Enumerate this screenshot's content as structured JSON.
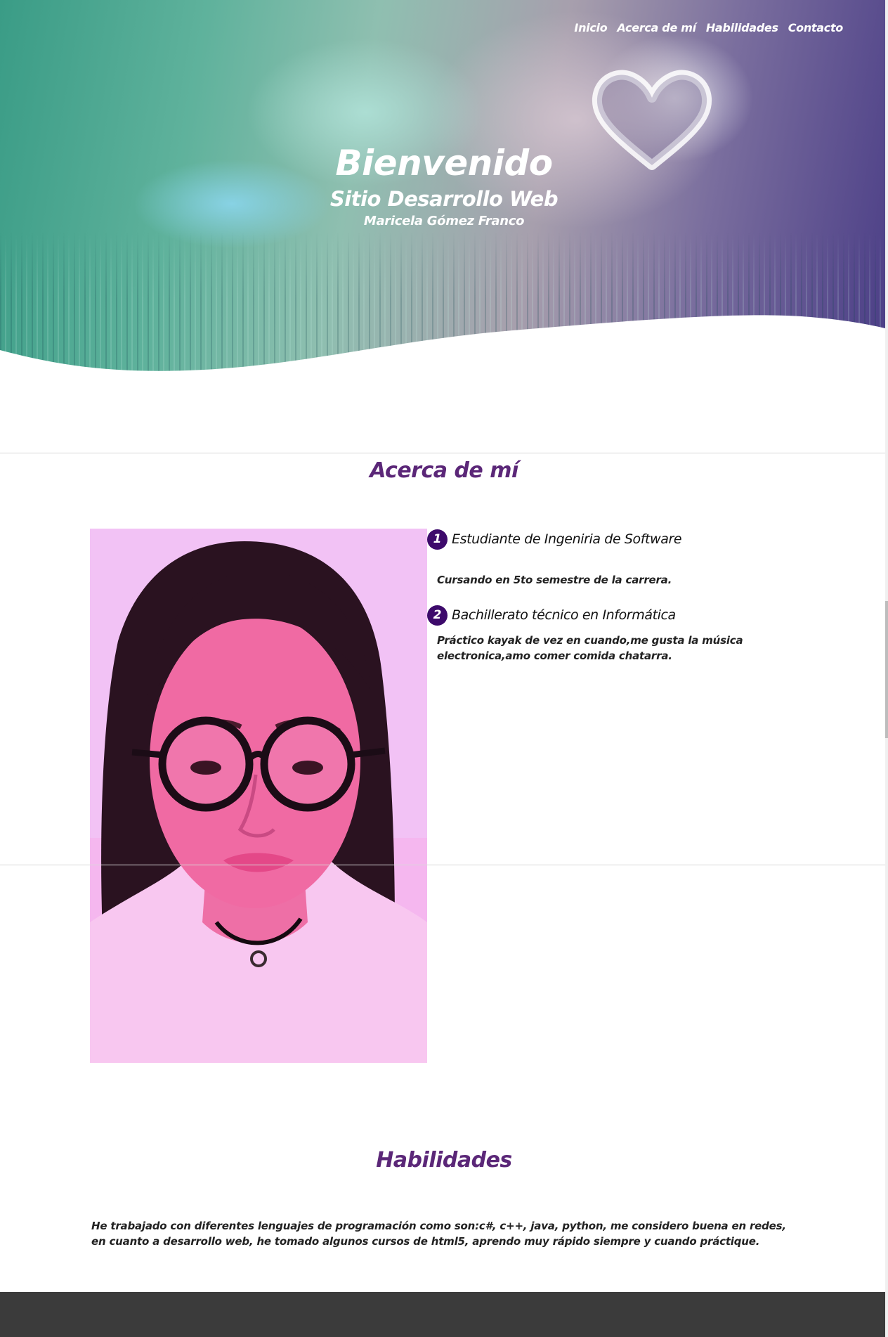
{
  "nav": {
    "items": [
      "Inicio",
      "Acerca de mí",
      "Habilidades",
      "Contacto"
    ]
  },
  "hero": {
    "title": "Bienvenido",
    "subtitle": "Sitio Desarrollo Web",
    "name": "Maricela Gómez Franco"
  },
  "about": {
    "title": "Acerca de mí",
    "items": [
      {
        "number": "1",
        "title": "Estudiante de Ingeniria de Software",
        "description": "Cursando en 5to semestre de la carrera."
      },
      {
        "number": "2",
        "title": "Bachillerato técnico en Informática",
        "description": "Práctico kayak de vez en cuando,me gusta la música electronica,amo comer comida chatarra."
      }
    ]
  },
  "skills": {
    "title": "Habilidades",
    "text": "He trabajado con diferentes lenguajes de programación como son:c#, c++, java, python, me considero buena en redes, en cuanto a desarrollo web, he tomado algunos cursos de html5, aprendo muy rápido siempre y cuando práctique."
  },
  "colors": {
    "heading": "#5b2778",
    "badge": "#3d0a6b",
    "footer": "#3b3b3b"
  }
}
